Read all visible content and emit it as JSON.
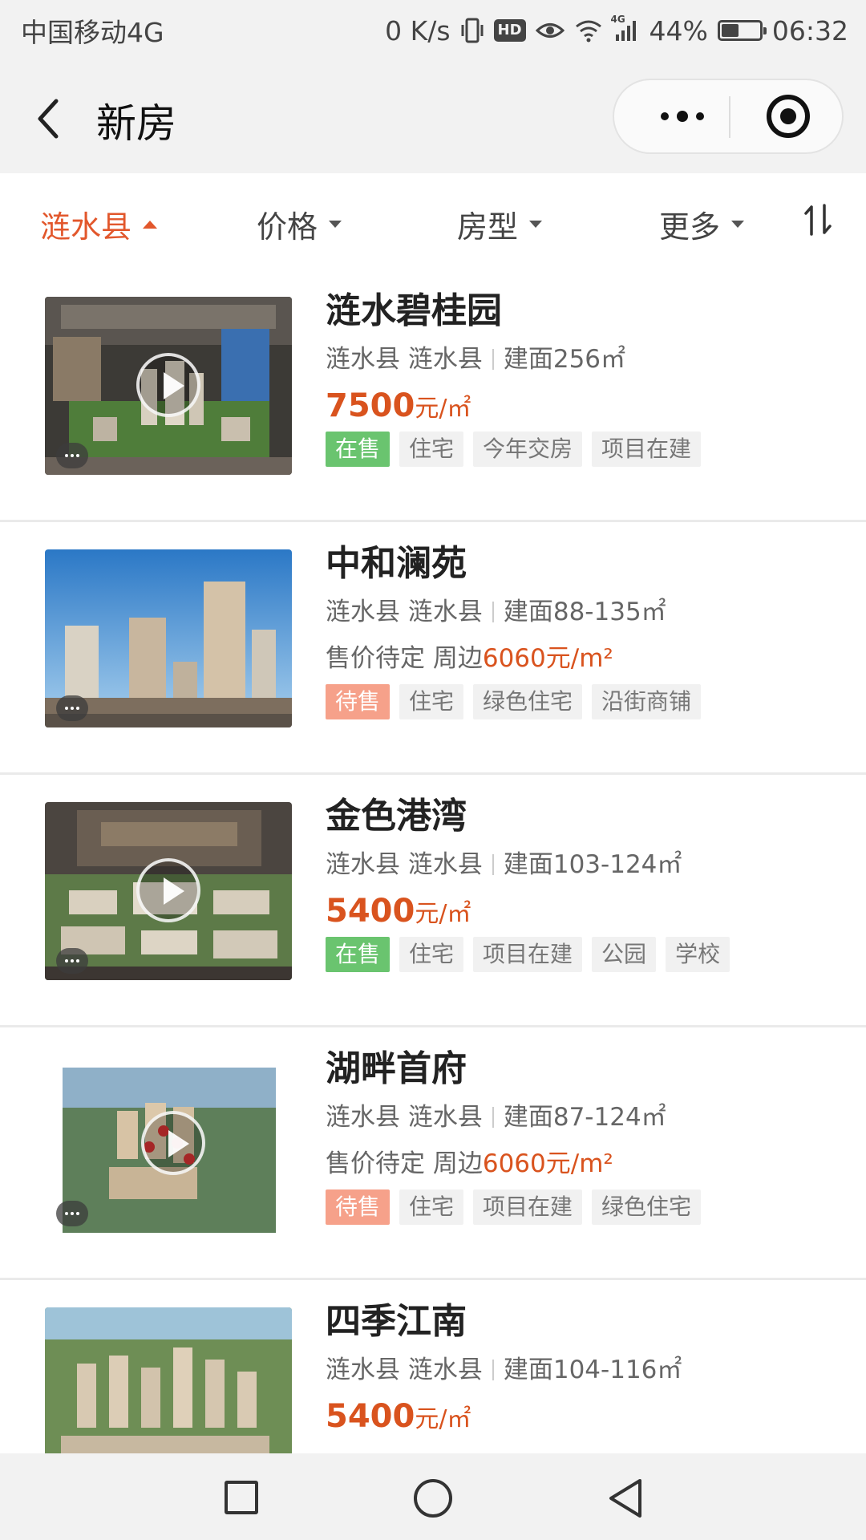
{
  "status_bar": {
    "carrier": "中国移动4G",
    "net_speed": "0 K/s",
    "hd": "HD",
    "signal_type": "4G",
    "battery_pct": "44%",
    "battery_level": 0.44,
    "time": "06:32"
  },
  "nav": {
    "title": "新房"
  },
  "filters": [
    {
      "label": "涟水县",
      "active": true
    },
    {
      "label": "价格",
      "active": false
    },
    {
      "label": "房型",
      "active": false
    },
    {
      "label": "更多",
      "active": false
    }
  ],
  "listings": [
    {
      "name": "涟水碧桂园",
      "district": "涟水县 涟水县",
      "area": "建面256㎡",
      "price_value": "7500",
      "price_unit": "元/㎡",
      "tags": [
        "在售",
        "住宅",
        "今年交房",
        "项目在建"
      ],
      "status": "onsale",
      "has_video": true
    },
    {
      "name": "中和澜苑",
      "district": "涟水县 涟水县",
      "area": "建面88-135㎡",
      "price_pending": "售价待定 周边",
      "price_nearby": "6060元/m²",
      "tags": [
        "待售",
        "住宅",
        "绿色住宅",
        "沿街商铺"
      ],
      "status": "pending",
      "has_video": false
    },
    {
      "name": "金色港湾",
      "district": "涟水县 涟水县",
      "area": "建面103-124㎡",
      "price_value": "5400",
      "price_unit": "元/㎡",
      "tags": [
        "在售",
        "住宅",
        "项目在建",
        "公园",
        "学校"
      ],
      "status": "onsale",
      "has_video": true
    },
    {
      "name": "湖畔首府",
      "district": "涟水县 涟水县",
      "area": "建面87-124㎡",
      "price_pending": "售价待定 周边",
      "price_nearby": "6060元/m²",
      "tags": [
        "待售",
        "住宅",
        "项目在建",
        "绿色住宅"
      ],
      "status": "pending",
      "has_video": true
    },
    {
      "name": "四季江南",
      "district": "涟水县 涟水县",
      "area": "建面104-116㎡",
      "price_value": "5400",
      "price_unit": "元/㎡",
      "tags": [],
      "status": "onsale",
      "has_video": false
    }
  ]
}
